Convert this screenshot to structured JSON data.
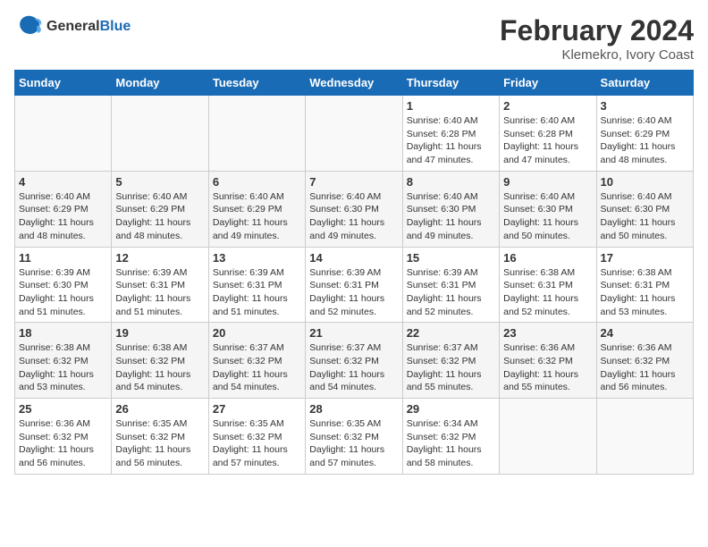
{
  "header": {
    "logo_general": "General",
    "logo_blue": "Blue",
    "title": "February 2024",
    "subtitle": "Klemekro, Ivory Coast"
  },
  "days_of_week": [
    "Sunday",
    "Monday",
    "Tuesday",
    "Wednesday",
    "Thursday",
    "Friday",
    "Saturday"
  ],
  "weeks": [
    [
      {
        "day": "",
        "info": ""
      },
      {
        "day": "",
        "info": ""
      },
      {
        "day": "",
        "info": ""
      },
      {
        "day": "",
        "info": ""
      },
      {
        "day": "1",
        "info": "Sunrise: 6:40 AM\nSunset: 6:28 PM\nDaylight: 11 hours\nand 47 minutes."
      },
      {
        "day": "2",
        "info": "Sunrise: 6:40 AM\nSunset: 6:28 PM\nDaylight: 11 hours\nand 47 minutes."
      },
      {
        "day": "3",
        "info": "Sunrise: 6:40 AM\nSunset: 6:29 PM\nDaylight: 11 hours\nand 48 minutes."
      }
    ],
    [
      {
        "day": "4",
        "info": "Sunrise: 6:40 AM\nSunset: 6:29 PM\nDaylight: 11 hours\nand 48 minutes."
      },
      {
        "day": "5",
        "info": "Sunrise: 6:40 AM\nSunset: 6:29 PM\nDaylight: 11 hours\nand 48 minutes."
      },
      {
        "day": "6",
        "info": "Sunrise: 6:40 AM\nSunset: 6:29 PM\nDaylight: 11 hours\nand 49 minutes."
      },
      {
        "day": "7",
        "info": "Sunrise: 6:40 AM\nSunset: 6:30 PM\nDaylight: 11 hours\nand 49 minutes."
      },
      {
        "day": "8",
        "info": "Sunrise: 6:40 AM\nSunset: 6:30 PM\nDaylight: 11 hours\nand 49 minutes."
      },
      {
        "day": "9",
        "info": "Sunrise: 6:40 AM\nSunset: 6:30 PM\nDaylight: 11 hours\nand 50 minutes."
      },
      {
        "day": "10",
        "info": "Sunrise: 6:40 AM\nSunset: 6:30 PM\nDaylight: 11 hours\nand 50 minutes."
      }
    ],
    [
      {
        "day": "11",
        "info": "Sunrise: 6:39 AM\nSunset: 6:30 PM\nDaylight: 11 hours\nand 51 minutes."
      },
      {
        "day": "12",
        "info": "Sunrise: 6:39 AM\nSunset: 6:31 PM\nDaylight: 11 hours\nand 51 minutes."
      },
      {
        "day": "13",
        "info": "Sunrise: 6:39 AM\nSunset: 6:31 PM\nDaylight: 11 hours\nand 51 minutes."
      },
      {
        "day": "14",
        "info": "Sunrise: 6:39 AM\nSunset: 6:31 PM\nDaylight: 11 hours\nand 52 minutes."
      },
      {
        "day": "15",
        "info": "Sunrise: 6:39 AM\nSunset: 6:31 PM\nDaylight: 11 hours\nand 52 minutes."
      },
      {
        "day": "16",
        "info": "Sunrise: 6:38 AM\nSunset: 6:31 PM\nDaylight: 11 hours\nand 52 minutes."
      },
      {
        "day": "17",
        "info": "Sunrise: 6:38 AM\nSunset: 6:31 PM\nDaylight: 11 hours\nand 53 minutes."
      }
    ],
    [
      {
        "day": "18",
        "info": "Sunrise: 6:38 AM\nSunset: 6:32 PM\nDaylight: 11 hours\nand 53 minutes."
      },
      {
        "day": "19",
        "info": "Sunrise: 6:38 AM\nSunset: 6:32 PM\nDaylight: 11 hours\nand 54 minutes."
      },
      {
        "day": "20",
        "info": "Sunrise: 6:37 AM\nSunset: 6:32 PM\nDaylight: 11 hours\nand 54 minutes."
      },
      {
        "day": "21",
        "info": "Sunrise: 6:37 AM\nSunset: 6:32 PM\nDaylight: 11 hours\nand 54 minutes."
      },
      {
        "day": "22",
        "info": "Sunrise: 6:37 AM\nSunset: 6:32 PM\nDaylight: 11 hours\nand 55 minutes."
      },
      {
        "day": "23",
        "info": "Sunrise: 6:36 AM\nSunset: 6:32 PM\nDaylight: 11 hours\nand 55 minutes."
      },
      {
        "day": "24",
        "info": "Sunrise: 6:36 AM\nSunset: 6:32 PM\nDaylight: 11 hours\nand 56 minutes."
      }
    ],
    [
      {
        "day": "25",
        "info": "Sunrise: 6:36 AM\nSunset: 6:32 PM\nDaylight: 11 hours\nand 56 minutes."
      },
      {
        "day": "26",
        "info": "Sunrise: 6:35 AM\nSunset: 6:32 PM\nDaylight: 11 hours\nand 56 minutes."
      },
      {
        "day": "27",
        "info": "Sunrise: 6:35 AM\nSunset: 6:32 PM\nDaylight: 11 hours\nand 57 minutes."
      },
      {
        "day": "28",
        "info": "Sunrise: 6:35 AM\nSunset: 6:32 PM\nDaylight: 11 hours\nand 57 minutes."
      },
      {
        "day": "29",
        "info": "Sunrise: 6:34 AM\nSunset: 6:32 PM\nDaylight: 11 hours\nand 58 minutes."
      },
      {
        "day": "",
        "info": ""
      },
      {
        "day": "",
        "info": ""
      }
    ]
  ]
}
